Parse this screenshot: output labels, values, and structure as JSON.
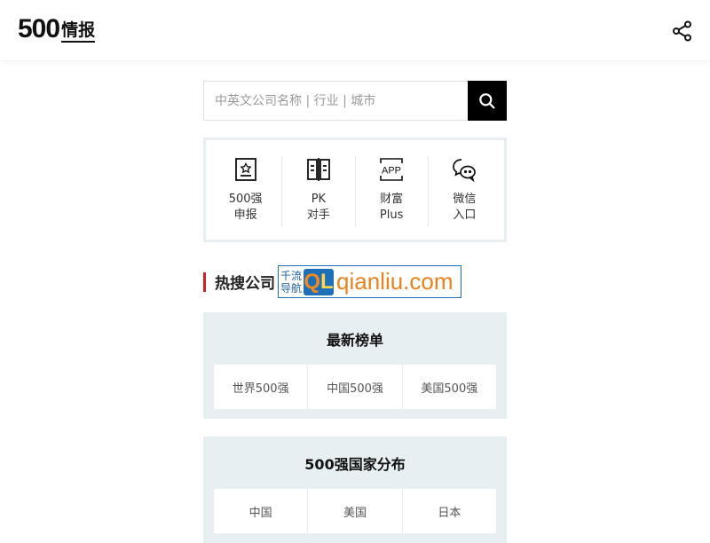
{
  "header": {
    "logo_number": "500",
    "logo_text": "情报",
    "share_icon": "share-icon"
  },
  "search": {
    "placeholder": "中英文公司名称 | 行业 | 城市",
    "value": "",
    "button_icon": "search-icon"
  },
  "quick_links": [
    {
      "icon": "star-certificate-icon",
      "line1": "500强",
      "line2": "申报"
    },
    {
      "icon": "compare-book-icon",
      "line1": "PK",
      "line2": "对手"
    },
    {
      "icon": "app-icon",
      "line1": "财富",
      "line2": "Plus"
    },
    {
      "icon": "wechat-icon",
      "line1": "微信",
      "line2": "入口"
    }
  ],
  "hot": {
    "title": "热搜公司",
    "badge_small_1": "千流",
    "badge_small_2": "导航",
    "badge_q": "Q",
    "badge_l": "L",
    "badge_domain": "qianliu.com"
  },
  "panels": [
    {
      "title": "最新榜单",
      "items": [
        "世界500强",
        "中国500强",
        "美国500强"
      ]
    },
    {
      "title": "500强国家分布",
      "items": [
        "中国",
        "美国",
        "日本"
      ]
    }
  ],
  "colors": {
    "accent_red": "#d0202a",
    "panel_bg": "#e7eff2",
    "badge_blue": "#1f6fb8",
    "badge_orange": "#e8831f"
  }
}
